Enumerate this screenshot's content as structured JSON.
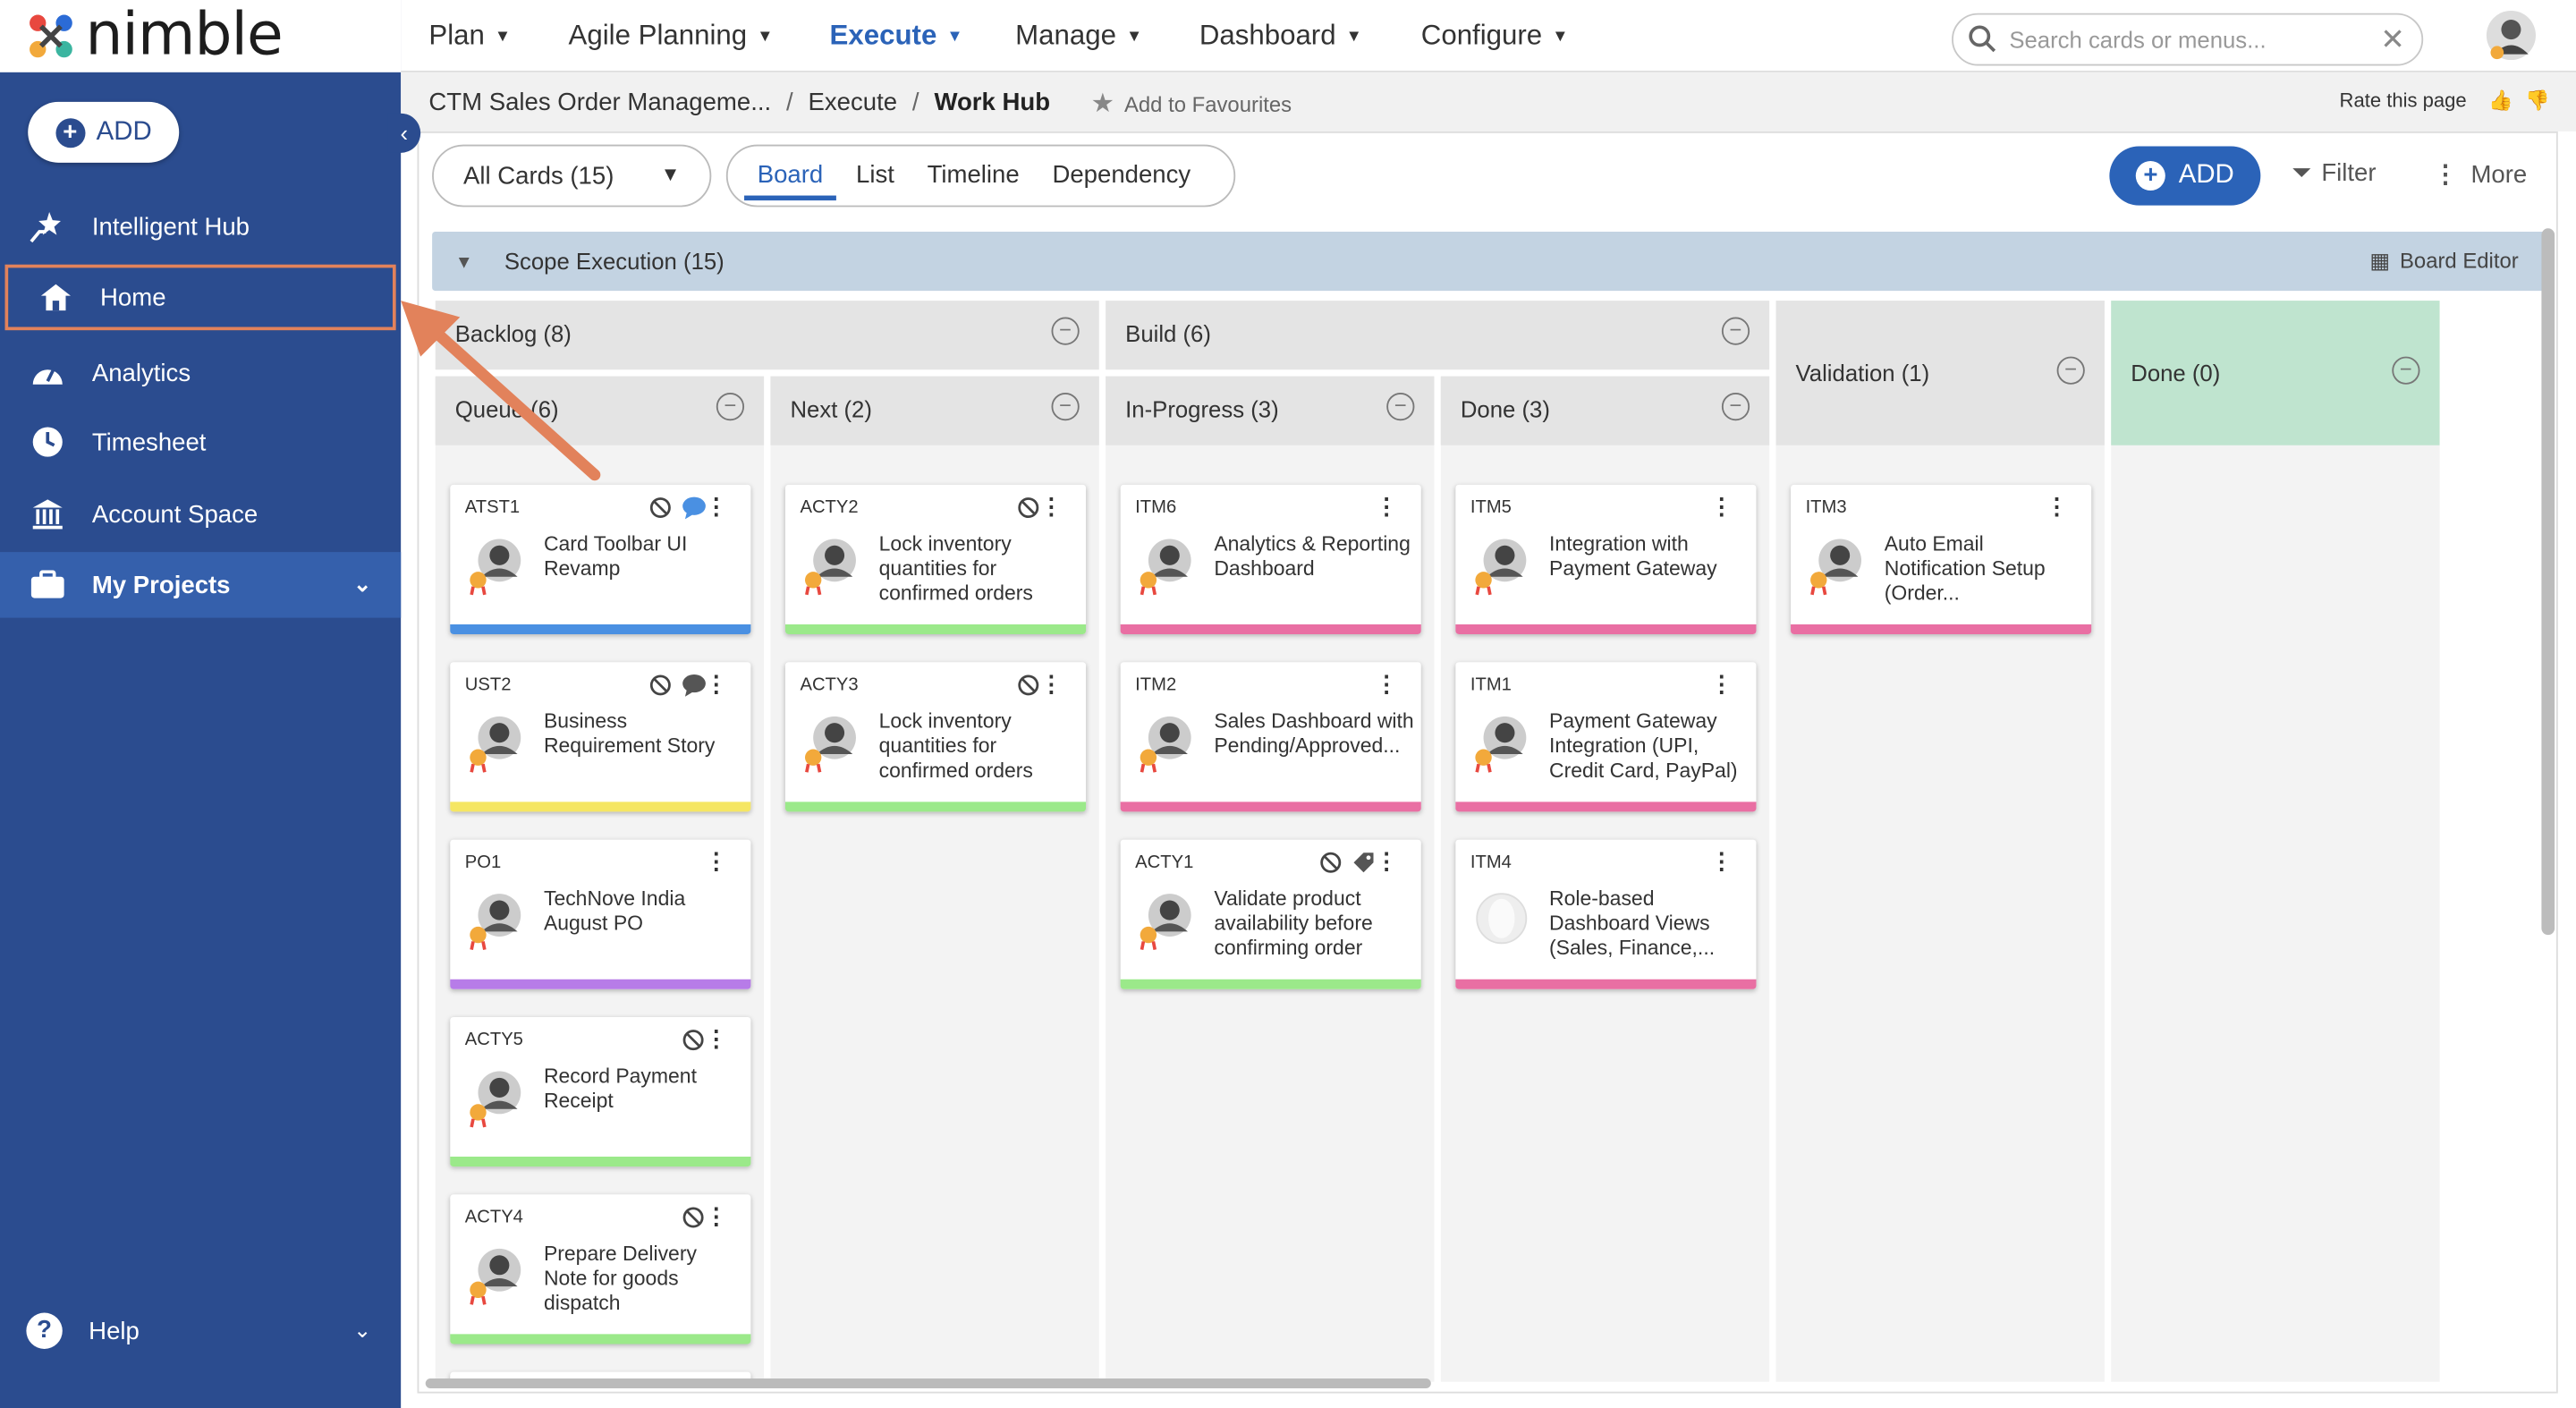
{
  "brand": {
    "name": "nimble"
  },
  "sidebar": {
    "add_label": "ADD",
    "items": [
      {
        "label": "Intelligent Hub",
        "icon": "star-hand-icon"
      },
      {
        "label": "Home",
        "icon": "home-icon"
      },
      {
        "label": "Analytics",
        "icon": "gauge-icon"
      },
      {
        "label": "Timesheet",
        "icon": "clock-icon"
      },
      {
        "label": "Account Space",
        "icon": "bank-icon"
      },
      {
        "label": "My Projects",
        "icon": "briefcase-icon"
      }
    ],
    "help_label": "Help"
  },
  "topnav": {
    "items": [
      "Plan",
      "Agile Planning",
      "Execute",
      "Manage",
      "Dashboard",
      "Configure"
    ],
    "active": "Execute",
    "search_placeholder": "Search cards or menus..."
  },
  "breadcrumb": {
    "project": "CTM Sales Order Manageme...",
    "section": "Execute",
    "page": "Work Hub",
    "favourite_label": "Add to Favourites",
    "rate_label": "Rate this page"
  },
  "toolbar": {
    "cards_filter": "All Cards (15)",
    "view_tabs": [
      "Board",
      "List",
      "Timeline",
      "Dependency"
    ],
    "active_view": "Board",
    "add_label": "ADD",
    "filter_label": "Filter",
    "more_label": "More"
  },
  "board": {
    "swimlane_title": "Scope Execution (15)",
    "board_editor_label": "Board Editor",
    "groups": {
      "backlog": "Backlog (8)",
      "build": "Build (6)",
      "validation": "Validation (1)",
      "done": "Done (0)"
    },
    "columns": {
      "queue": "Queue (6)",
      "next": "Next (2)",
      "inprogress": "In-Progress (3)",
      "done": "Done (3)"
    },
    "cards": {
      "queue": [
        {
          "id": "ATST1",
          "title": "Card Toolbar UI Revamp"
        },
        {
          "id": "UST2",
          "title": "Business Requirement Story"
        },
        {
          "id": "PO1",
          "title": "TechNove India August PO"
        },
        {
          "id": "ACTY5",
          "title": "Record Payment Receipt"
        },
        {
          "id": "ACTY4",
          "title": "Prepare Delivery Note for goods dispatch"
        }
      ],
      "next": [
        {
          "id": "ACTY2",
          "title": "Lock inventory quantities for confirmed orders"
        },
        {
          "id": "ACTY3",
          "title": "Lock inventory quantities for confirmed orders"
        }
      ],
      "inprogress": [
        {
          "id": "ITM6",
          "title": "Analytics & Reporting Dashboard"
        },
        {
          "id": "ITM2",
          "title": "Sales Dashboard with Pending/Approved..."
        },
        {
          "id": "ACTY1",
          "title": "Validate product availability before confirming order"
        }
      ],
      "done": [
        {
          "id": "ITM5",
          "title": "Integration with Payment Gateway"
        },
        {
          "id": "ITM1",
          "title": "Payment Gateway Integration (UPI, Credit Card, PayPal)"
        },
        {
          "id": "ITM4",
          "title": "Role-based Dashboard Views (Sales, Finance,..."
        }
      ],
      "validation": [
        {
          "id": "ITM3",
          "title": "Auto Email Notification Setup (Order..."
        }
      ]
    }
  },
  "colors": {
    "sidebar": "#2b4c8f",
    "accent": "#2b63b8",
    "highlight": "#e2825b",
    "bar_blue": "#4a90e2",
    "bar_yellow": "#f5e663",
    "bar_purple": "#b77ce8",
    "bar_green": "#9be98a",
    "bar_pink": "#e96fa3",
    "done_header": "#bfe4cf"
  }
}
